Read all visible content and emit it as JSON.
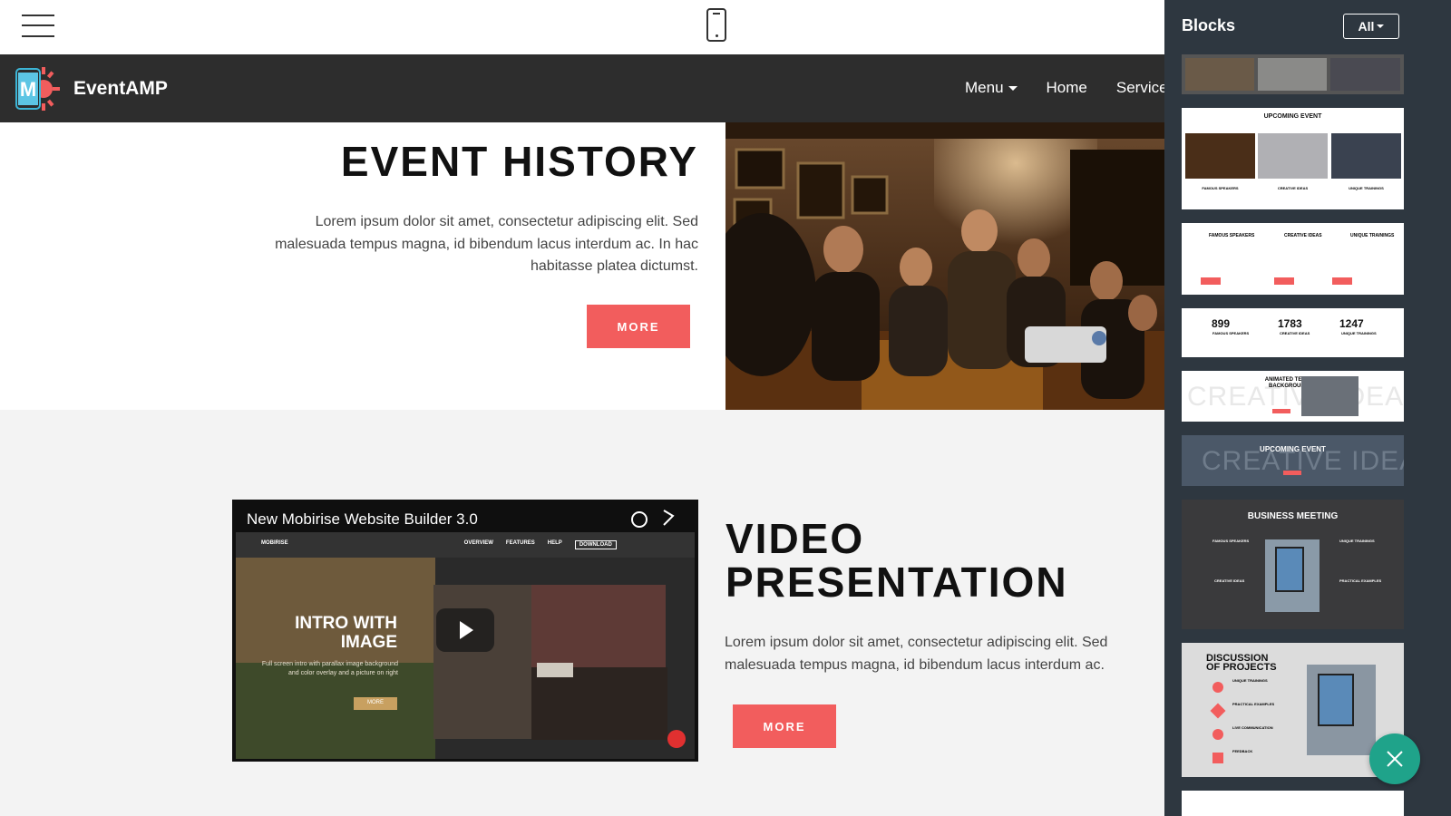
{
  "toolbar": {
    "menu_icon": "hamburger-icon",
    "preview_icon": "mobile-phone-icon"
  },
  "navbar": {
    "brand": "EventAMP",
    "logo_letter": "M",
    "links": [
      {
        "label": "Menu",
        "has_caret": true
      },
      {
        "label": "Home",
        "has_caret": false
      },
      {
        "label": "Services",
        "has_caret": false
      }
    ]
  },
  "event_history": {
    "title": "EVENT HISTORY",
    "text": "Lorem ipsum dolor sit amet, consectetur adipiscing elit. Sed malesuada tempus magna, id bibendum lacus interdum ac. In hac habitasse platea dictumst.",
    "button": "MORE"
  },
  "video_section": {
    "video_title": "New Mobirise Website Builder 3.0",
    "video_nav": [
      "MOBIRISE",
      "OVERVIEW",
      "FEATURES",
      "HELP",
      "DOWNLOAD"
    ],
    "video_heading": "INTRO WITH IMAGE",
    "video_sub": "Full screen intro with parallax image background and color overlay and a picture on right",
    "video_btn": "MORE",
    "title_line1": "VIDEO",
    "title_line2": "PRESENTATION",
    "text": "Lorem ipsum dolor sit amet, consectetur adipiscing elit. Sed malesuada tempus magna, id bibendum lacus interdum ac.",
    "button": "MORE"
  },
  "panel": {
    "title": "Blocks",
    "filter": "All",
    "thumbs": {
      "upcoming": "UPCOMING EVENT",
      "features": [
        "FAMOUS SPEAKERS",
        "CREATIVE IDEAS",
        "UNIQUE TRAININGS"
      ],
      "counters": [
        "899",
        "1783",
        "1247"
      ],
      "counter_labels": [
        "FAMOUS SPEAKERS",
        "CREATIVE IDEAS",
        "UNIQUE TRAININGS"
      ],
      "animated_title": "ANIMATED TEXT BACKGROUND",
      "animated_bg": "CREATIVE IDEAS",
      "upcoming2": "UPCOMING EVENT",
      "upcoming2_bg": "CREATIVE IDEA",
      "business": "BUSINESS MEETING",
      "business_items": [
        "FAMOUS SPEAKERS",
        "UNIQUE TRAININGS",
        "CREATIVE IDEAS",
        "PRACTICAL EXAMPLES"
      ],
      "discussion_line1": "DISCUSSION",
      "discussion_line2": "OF PROJECTS",
      "discussion_items": [
        "UNIQUE TRAININGS",
        "PRACTICAL EXAMPLES",
        "LIVE COMMUNICATION",
        "FEEDBACK"
      ]
    }
  },
  "colors": {
    "accent": "#f25d5d",
    "navbar": "#2d2d2d",
    "panel": "#2e3740",
    "fab": "#1fa38a"
  }
}
